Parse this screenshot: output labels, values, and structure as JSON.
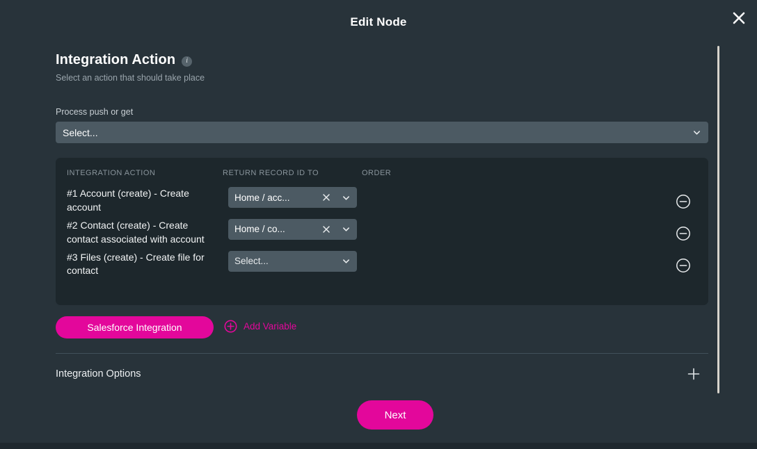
{
  "window": {
    "title": "Edit Node",
    "close_icon": "close-icon"
  },
  "section": {
    "title": "Integration Action",
    "info_icon": "info-icon",
    "subtitle": "Select an action that should take place"
  },
  "process_field": {
    "label": "Process push or get",
    "selected": "Select...",
    "chevron_icon": "chevron-down-icon"
  },
  "table": {
    "headers": {
      "action": "INTEGRATION ACTION",
      "return": "RETURN RECORD ID TO",
      "order": "ORDER"
    },
    "rows": [
      {
        "action": "#1 Account (create) - Create account",
        "return_value": "Home / acc...",
        "has_value": true,
        "clear_icon": "clear-x-icon",
        "chevron_icon": "chevron-down-icon",
        "remove_icon": "minus-circle-icon",
        "order": ""
      },
      {
        "action": "#2 Contact (create) - Create contact associated with account",
        "return_value": "Home / co...",
        "has_value": true,
        "clear_icon": "clear-x-icon",
        "chevron_icon": "chevron-down-icon",
        "remove_icon": "minus-circle-icon",
        "order": ""
      },
      {
        "action": "#3 Files (create) - Create file for contact",
        "return_value": "Select...",
        "has_value": false,
        "clear_icon": "clear-x-icon",
        "chevron_icon": "chevron-down-icon",
        "remove_icon": "minus-circle-icon",
        "order": ""
      }
    ]
  },
  "actions": {
    "integration_button": "Salesforce Integration",
    "add_variable_label": "Add Variable",
    "add_variable_icon": "plus-circle-icon"
  },
  "options": {
    "label": "Integration Options",
    "expand_icon": "plus-icon"
  },
  "footer": {
    "next_label": "Next"
  },
  "colors": {
    "accent": "#e3079b",
    "page_background": "#28333a",
    "panel_background": "#1d272c",
    "input_background": "#4c5a63",
    "muted_text": "#8a959c"
  }
}
